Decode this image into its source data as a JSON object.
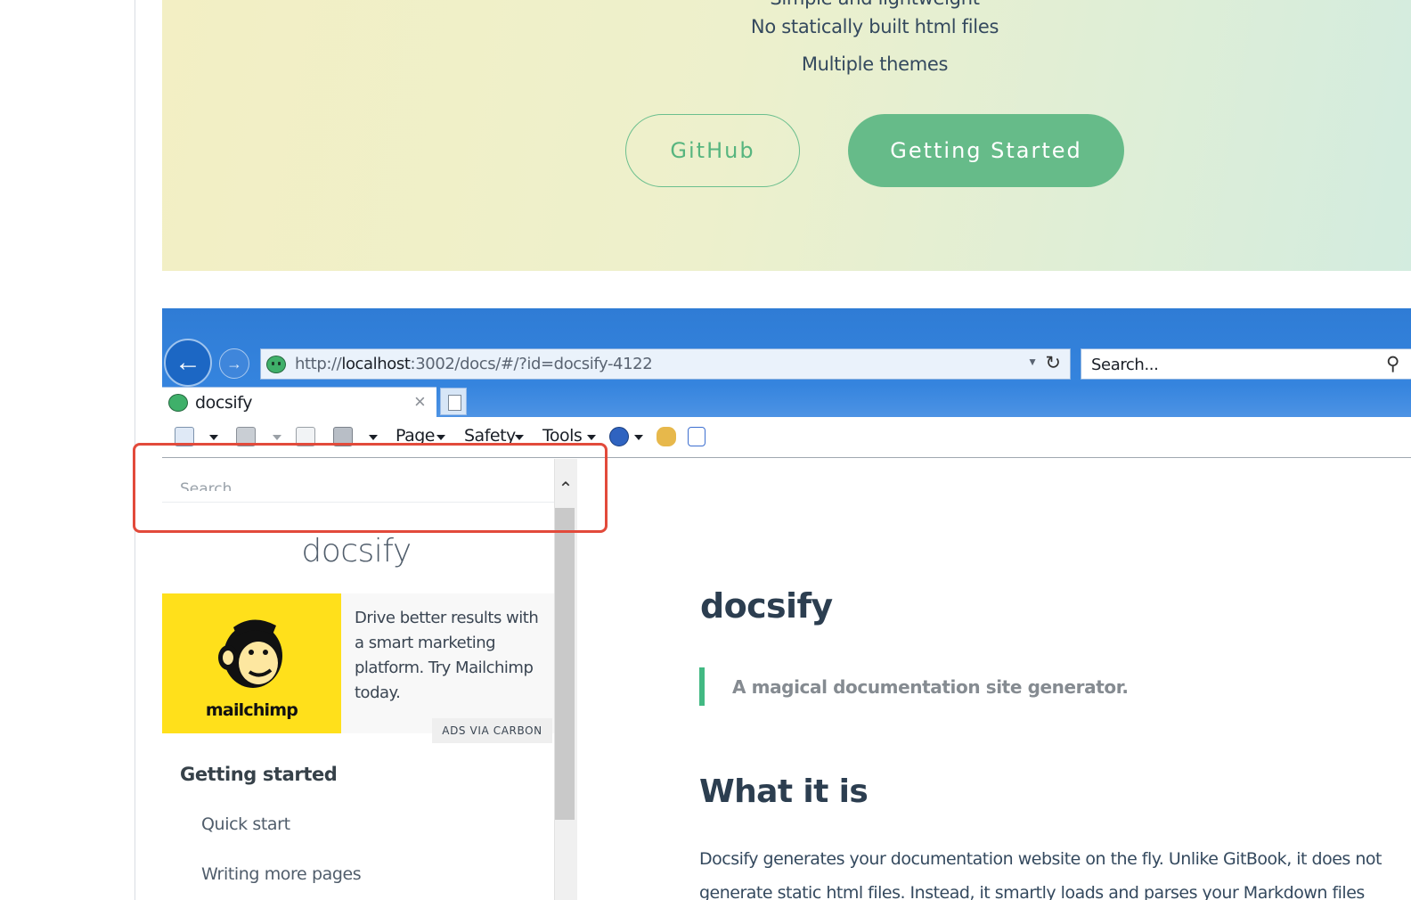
{
  "hero": {
    "line_top": "Simple and lightweight",
    "line1": "No statically built html files",
    "line2": "Multiple themes",
    "github_button": "GitHub",
    "getting_started_button": "Getting Started"
  },
  "browser": {
    "address": {
      "scheme": "http://",
      "host": "localhost",
      "path": ":3002/docs/#/?id=docsify-4122"
    },
    "search_placeholder": "Search...",
    "tab_title": "docsify",
    "commands": {
      "page": "Page",
      "safety": "Safety",
      "tools": "Tools"
    }
  },
  "sidebar": {
    "search_placeholder": "Search",
    "title": "docsify",
    "ad": {
      "brand": "mailchimp",
      "text": "Drive better results with a smart marketing platform. Try Mailchimp today.",
      "via": "ADS VIA CARBON"
    },
    "section": "Getting started",
    "links": [
      "Quick start",
      "Writing more pages"
    ]
  },
  "content": {
    "title": "docsify",
    "tagline": "A magical documentation site generator.",
    "heading": "What it is",
    "paragraph_line1": "Docsify generates your documentation website on the fly. Unlike GitBook, it does not",
    "paragraph_line2": "generate static html files. Instead, it smartly loads and parses your Markdown files"
  },
  "colors": {
    "accent": "#42b983",
    "browser_blue": "#3584de",
    "highlight": "#e24a3b"
  }
}
